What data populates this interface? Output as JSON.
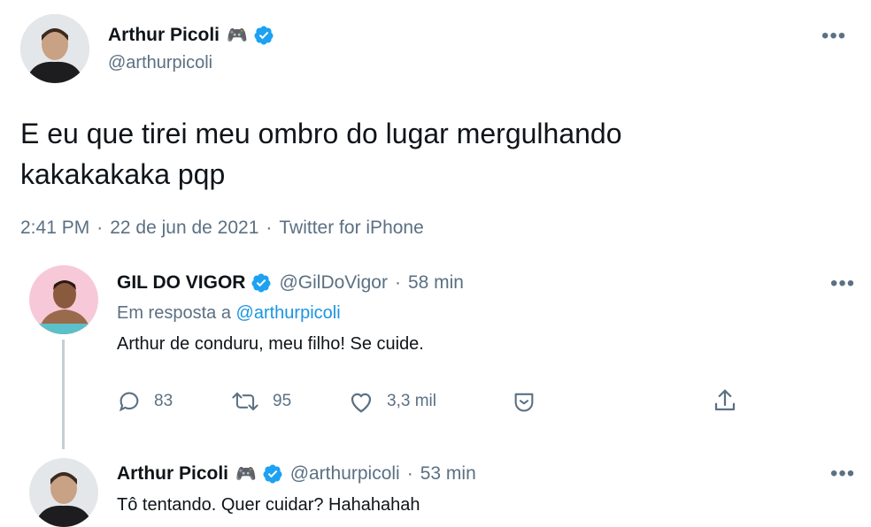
{
  "main_tweet": {
    "author_name": "Arthur Picoli",
    "author_emoji": "🎮",
    "handle": "@arthurpicoli",
    "text_line1": "E eu que tirei meu ombro do lugar mergulhando",
    "text_line2": "kakakakaka pqp",
    "time": "2:41 PM",
    "date": "22 de jun de 2021",
    "source": "Twitter for iPhone",
    "sep": "·"
  },
  "reply1": {
    "author_name": "GIL DO VIGOR",
    "handle": "@GilDoVigor",
    "age": "58 min",
    "reply_prefix": "Em resposta a",
    "reply_to": "@arthurpicoli",
    "text": "Arthur de conduru, meu filho! Se cuide.",
    "replies": "83",
    "retweets": "95",
    "likes": "3,3 mil",
    "sep": "·"
  },
  "reply2": {
    "author_name": "Arthur Picoli",
    "author_emoji": "🎮",
    "handle": "@arthurpicoli",
    "age": "53 min",
    "text": "Tô tentando. Quer cuidar? Hahahahah",
    "sep": "·"
  },
  "menu_glyph": "•••",
  "colors": {
    "accent": "#1da1f2",
    "muted": "#5b7083",
    "text": "#0f1419"
  }
}
